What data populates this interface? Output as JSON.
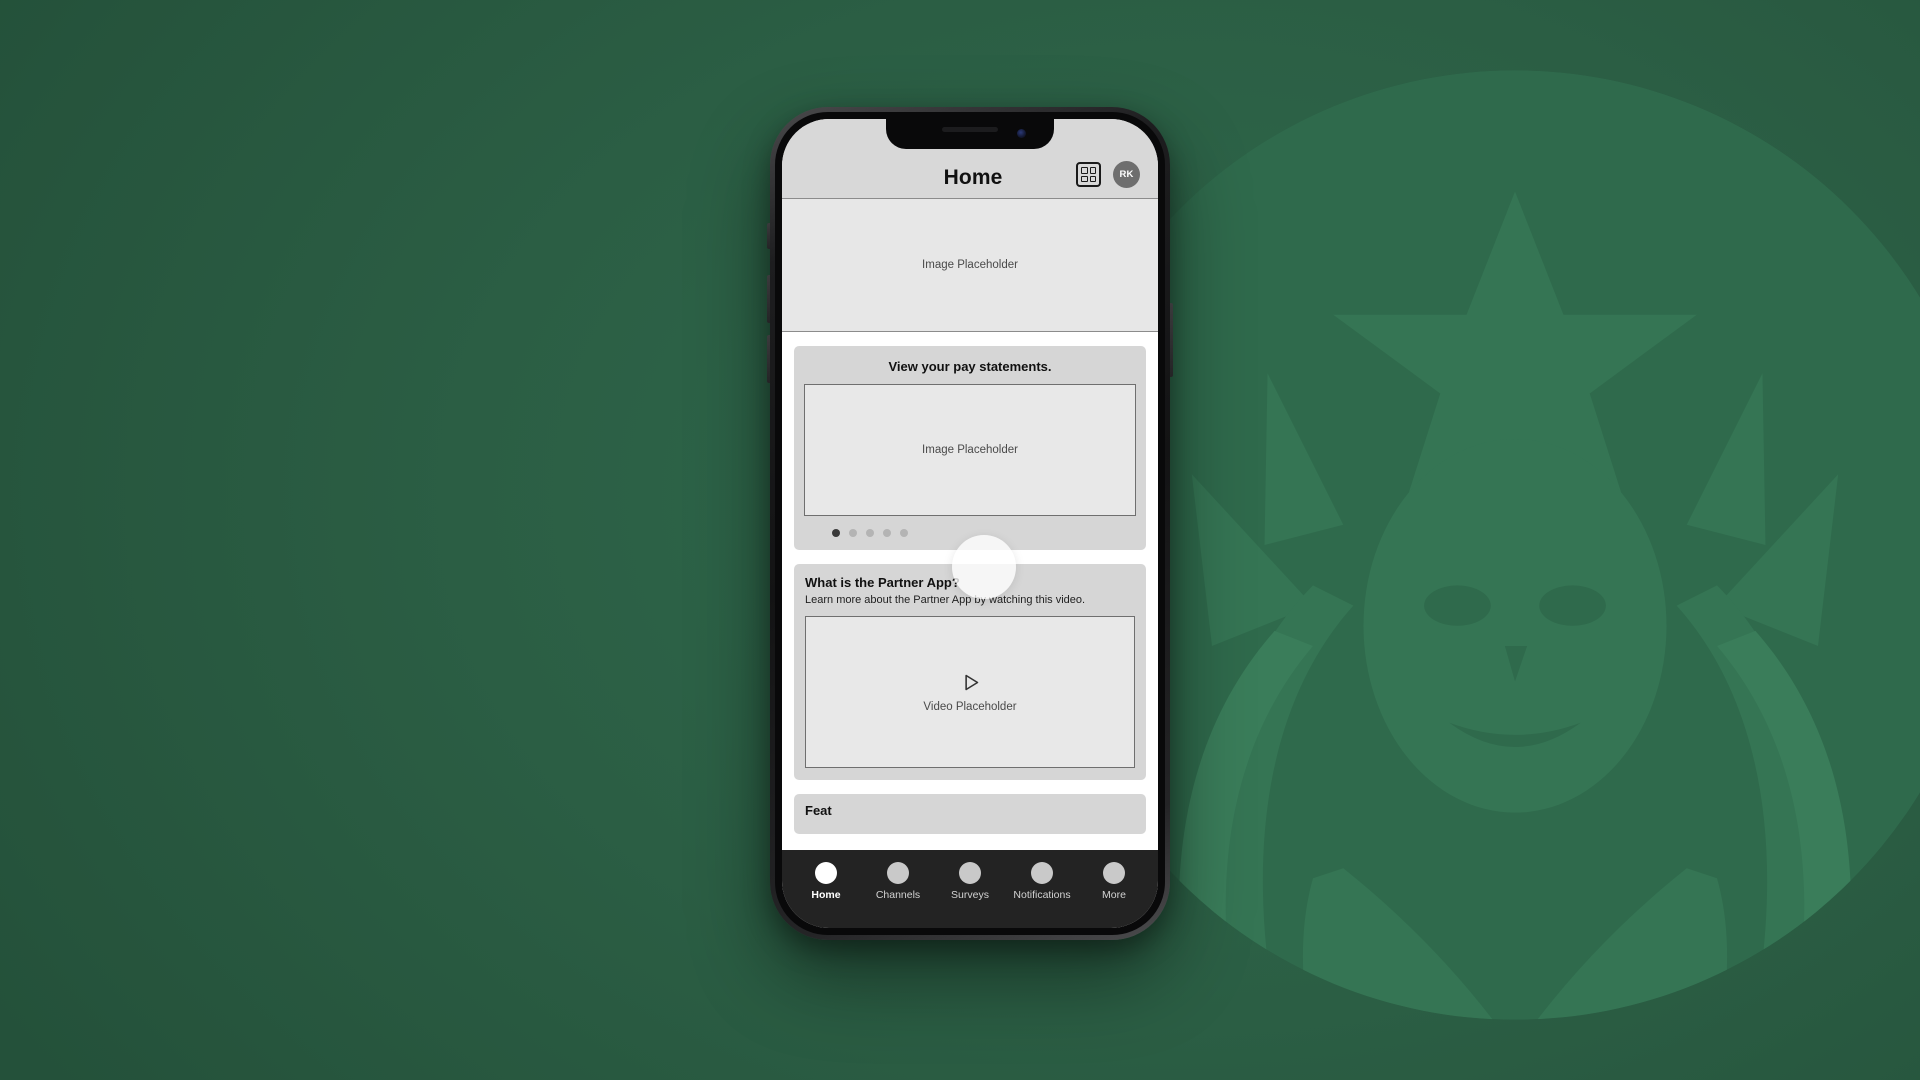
{
  "background": {
    "color": "#2b5e44",
    "watermark": "starbucks-siren-logo"
  },
  "device": {
    "type": "iphone-mockup",
    "status_indicators": [
      "notch-speaker",
      "notch-camera"
    ]
  },
  "header": {
    "title": "Home",
    "grid_icon": "grid-apps-icon",
    "avatar_initials": "RK"
  },
  "hero": {
    "placeholder_text": "Image Placeholder"
  },
  "pay_card": {
    "title": "View your pay statements.",
    "placeholder_text": "Image Placeholder",
    "dots_total": 5,
    "dots_active_index": 0
  },
  "partner_card": {
    "title": "What is the Partner App?",
    "subtitle": "Learn more about the Partner App by watching this video.",
    "video_placeholder_text": "Video Placeholder",
    "play_icon": "play-triangle-icon"
  },
  "cut_card": {
    "title": "Feat"
  },
  "tabs": [
    {
      "label": "Home",
      "icon": "home-icon",
      "active": true
    },
    {
      "label": "Channels",
      "icon": "channels-icon",
      "active": false
    },
    {
      "label": "Surveys",
      "icon": "surveys-icon",
      "active": false
    },
    {
      "label": "Notifications",
      "icon": "notifications-icon",
      "active": false
    },
    {
      "label": "More",
      "icon": "more-icon",
      "active": false
    }
  ],
  "overlay": {
    "touch_highlight": "touch-highlight-circle"
  }
}
